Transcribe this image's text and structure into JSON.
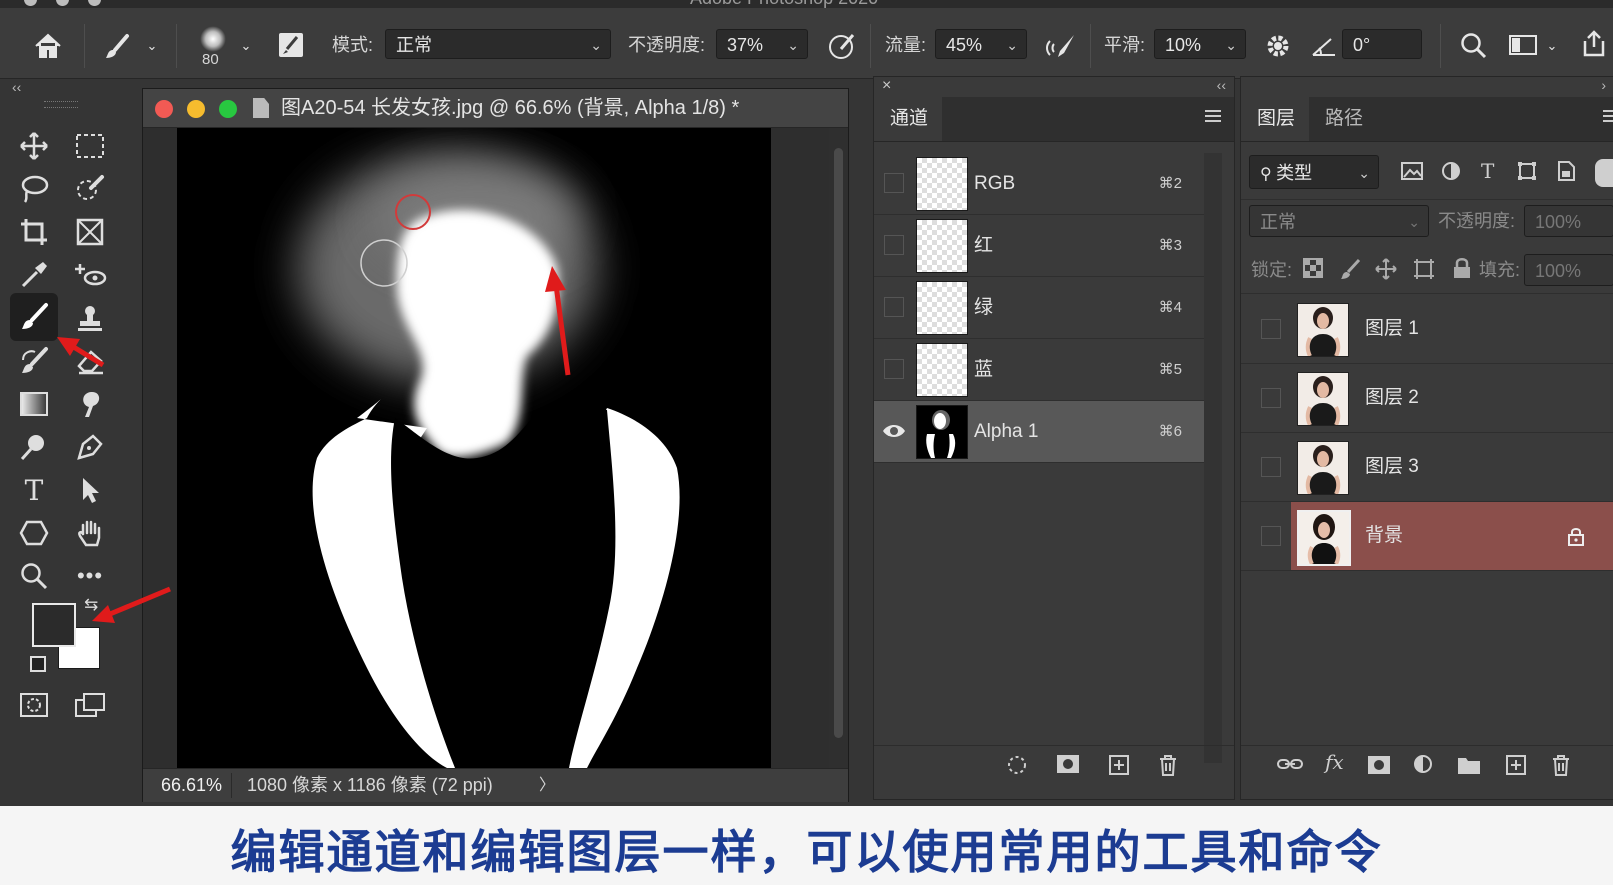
{
  "app": {
    "title": "Adobe Photoshop 2020"
  },
  "options_bar": {
    "brush_size": "80",
    "mode_label": "模式:",
    "mode_value": "正常",
    "opacity_label": "不透明度:",
    "opacity_value": "37%",
    "flow_label": "流量:",
    "flow_value": "45%",
    "smoothing_label": "平滑:",
    "smoothing_value": "10%",
    "angle_value": "0°"
  },
  "colors": {
    "foreground": "#2b2b2b",
    "background": "#ffffff",
    "accent_layer_selected": "#8b4f4b",
    "subtitle_text": "#1c3c92"
  },
  "document": {
    "tab_title": "图A20-54 长发女孩.jpg @ 66.6% (背景, Alpha 1/8) *",
    "zoom": "66.61%",
    "dimensions": "1080 像素 x 1186 像素 (72 ppi)",
    "status_arrow": "〉"
  },
  "channels_panel": {
    "tab": "通道",
    "channels": [
      {
        "name": "RGB",
        "shortcut": "⌘2",
        "visible": false
      },
      {
        "name": "红",
        "shortcut": "⌘3",
        "visible": false
      },
      {
        "name": "绿",
        "shortcut": "⌘4",
        "visible": false
      },
      {
        "name": "蓝",
        "shortcut": "⌘5",
        "visible": false
      },
      {
        "name": "Alpha 1",
        "shortcut": "⌘6",
        "visible": true
      }
    ]
  },
  "layers_panel": {
    "tabs": [
      "图层",
      "路径"
    ],
    "filter_label": "类型",
    "blend_mode": "正常",
    "opacity_label": "不透明度:",
    "opacity_value": "100%",
    "lock_label": "锁定:",
    "fill_label": "填充:",
    "fill_value": "100%",
    "layers": [
      {
        "name": "图层 1",
        "selected": false
      },
      {
        "name": "图层 2",
        "selected": false
      },
      {
        "name": "图层 3",
        "selected": false
      },
      {
        "name": "背景",
        "selected": true,
        "locked": true
      }
    ]
  },
  "subtitle": "编辑通道和编辑图层一样，可以使用常用的工具和命令"
}
